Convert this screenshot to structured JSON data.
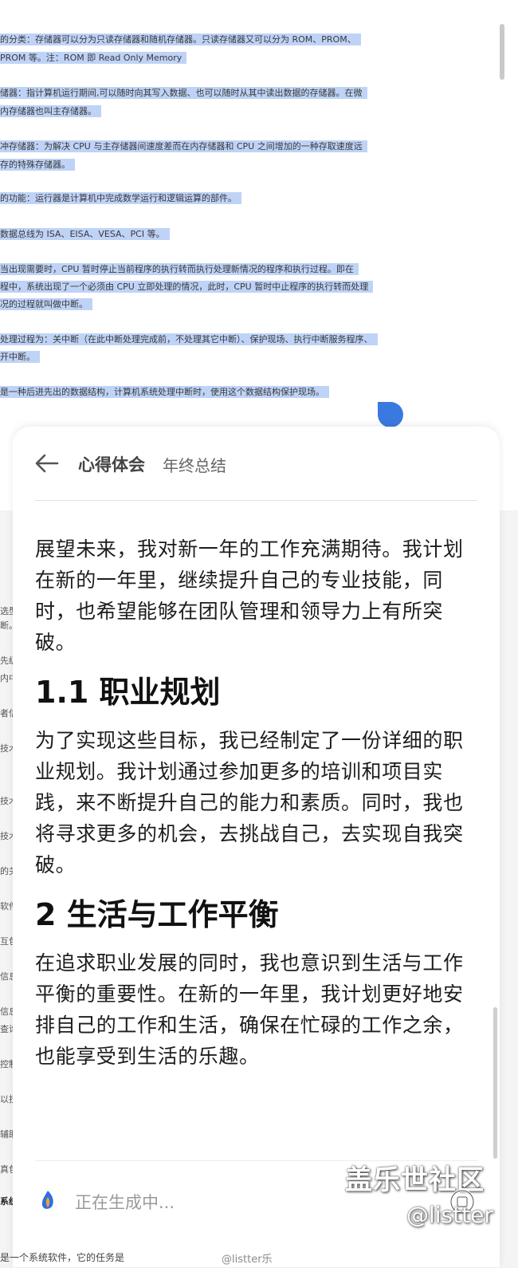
{
  "background_doc": {
    "lines": [
      "的分类：存储器可以分为只读存储器和随机存储器。只读存储器又可以分为 ROM、PROM、",
      "PROM 等。注：ROM 即 Read Only Memory",
      "储器：指计算机运行期间,可以随时向其写入数据、也可以随时从其中读出数据的存储器。在微",
      "内存储器也叫主存储器。",
      "冲存储器：为解决 CPU 与主存储器间速度差而在内存储器和 CPU 之间增加的一种存取速度远",
      "存的特殊存储器。",
      "的功能：运行器是计算机中完成数学运行和逻辑运算的部件。",
      "数据总线为 ISA、EISA、VESA、PCI 等。",
      "当出现需要时，CPU 暂时停止当前程序的执行转而执行处理新情况的程序和执行过程。即在",
      "程中，系统出现了一个必须由 CPU 立即处理的情况，此时，CPU 暂时中止程序的执行转而处理",
      "况的过程就叫做中断。",
      "处理过程为：关中断（在此中断处理完成前，不处理其它中断）、保护现场、执行中断服务程序、",
      "开中断。",
      "是一种后进先出的数据结构，计算机系统处理中断时，使用这个数据结构保护现场。"
    ]
  },
  "left_column": [
    "选型",
    "断。",
    "先级",
    "内中",
    "者信",
    "技术",
    "技术",
    "技术",
    "的关",
    "软件",
    "互包",
    "信息",
    "信息",
    "查询",
    "控制",
    "以技",
    "辅助",
    "真包",
    "系统"
  ],
  "sheet": {
    "header": {
      "title": "心得体会",
      "subtitle": "年终总结"
    },
    "para1": "展望未来，我对新一年的工作充满期待。我计划在新的一年里，继续提升自己的专业技能，同时，也希望能够在团队管理和领导力上有所突破。",
    "heading1": "1.1  职业规划",
    "para2": "为了实现这些目标，我已经制定了一份详细的职业规划。我计划通过参加更多的培训和项目实践，来不断提升自己的能力和素质。同时，我也将寻求更多的机会，去挑战自己，去实现自我突破。",
    "heading2": "2  生活与工作平衡",
    "para3": "在追求职业发展的同时，我也意识到生活与工作平衡的重要性。在新的一年里，我计划更好地安排自己的工作和生活，确保在忙碌的工作之余，也能享受到生活的乐趣。",
    "generating": "正在生成中..."
  },
  "bottom_text": "是一个系统软件，它的任务是",
  "watermark": {
    "main": "盖乐世社区",
    "handle": "@listter",
    "bottom": "@listter乐"
  },
  "colors": {
    "selection": "#bfd3f7",
    "handle": "#3a7ae0",
    "icon_blue": "#2f6fe0",
    "icon_orange": "#f0a030"
  },
  "icons": [
    "back-arrow-icon",
    "ai-assistant-icon",
    "camera-watermark-icon"
  ]
}
